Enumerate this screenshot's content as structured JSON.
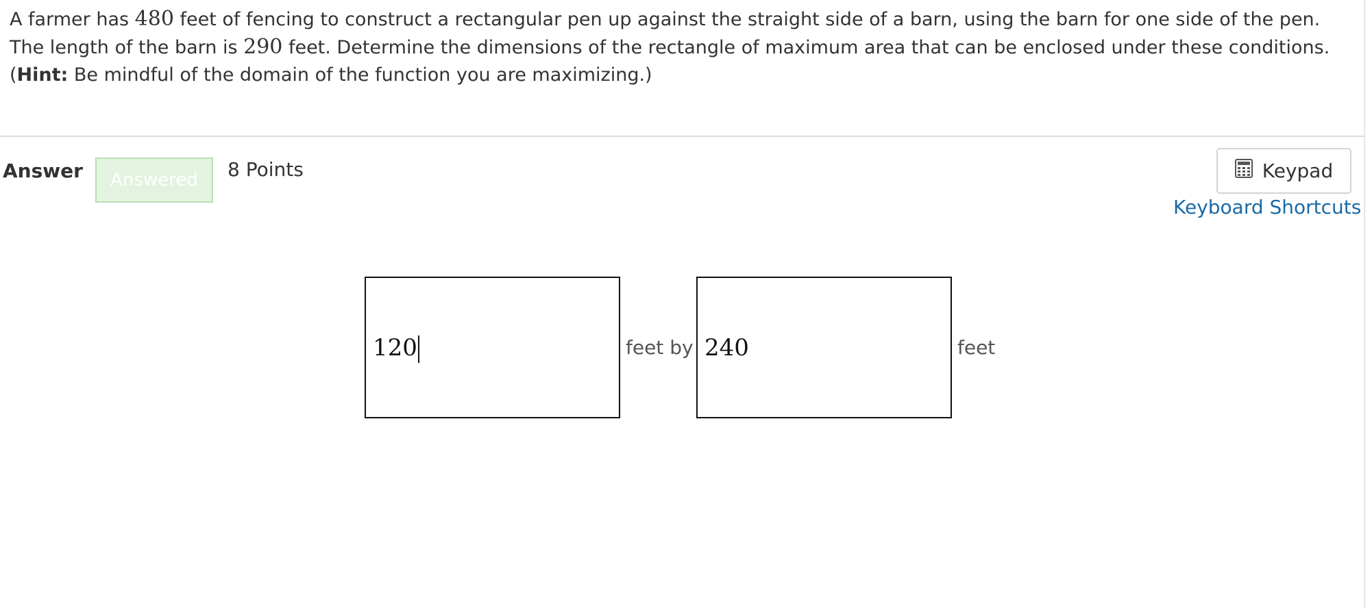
{
  "question": {
    "text_1": "A farmer has ",
    "fence_length": "480",
    "text_2": " feet of fencing to construct a rectangular pen up against the straight side of a barn, using the barn for one side of the pen. The length of the barn is ",
    "barn_length": "290",
    "text_3": " feet. Determine the dimensions of the rectangle of maximum area that can be enclosed under these conditions. (",
    "hint_label": "Hint:",
    "hint_text": " Be mindful of the domain of the function you are maximizing.)"
  },
  "answer": {
    "label": "Answer",
    "status_badge": "Answered",
    "points": "8 Points"
  },
  "tools": {
    "keypad_label": "Keypad",
    "keypad_icon": "calculator-icon",
    "shortcuts_label": "Keyboard Shortcuts"
  },
  "inputs": {
    "width_value": "120",
    "between_label": "feet by",
    "length_value": "240",
    "unit_label": "feet"
  },
  "colors": {
    "link": "#1a6aa6",
    "badge_background": "#e4f3e0",
    "badge_border": "#b9dfb1"
  }
}
